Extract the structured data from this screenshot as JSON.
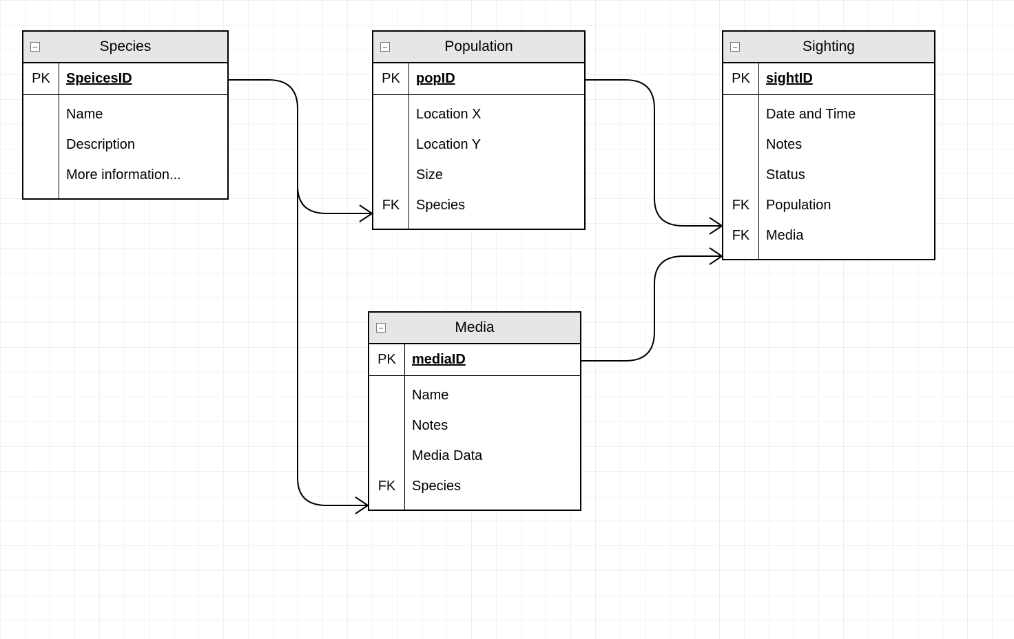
{
  "entities": {
    "species": {
      "title": "Species",
      "pk_label": "PK",
      "pk_attr": "SpeicesID",
      "rows": [
        {
          "key": "",
          "attr": "Name"
        },
        {
          "key": "",
          "attr": "Description"
        },
        {
          "key": "",
          "attr": "More information..."
        }
      ]
    },
    "population": {
      "title": "Population",
      "pk_label": "PK",
      "pk_attr": "popID",
      "rows": [
        {
          "key": "",
          "attr": "Location X"
        },
        {
          "key": "",
          "attr": "Location Y"
        },
        {
          "key": "",
          "attr": "Size"
        },
        {
          "key": "FK",
          "attr": "Species"
        }
      ]
    },
    "sighting": {
      "title": "Sighting",
      "pk_label": "PK",
      "pk_attr": "sightID",
      "rows": [
        {
          "key": "",
          "attr": "Date and Time"
        },
        {
          "key": "",
          "attr": "Notes"
        },
        {
          "key": "",
          "attr": "Status"
        },
        {
          "key": "FK",
          "attr": "Population"
        },
        {
          "key": "FK",
          "attr": "Media"
        }
      ]
    },
    "media": {
      "title": "Media",
      "pk_label": "PK",
      "pk_attr": "mediaID",
      "rows": [
        {
          "key": "",
          "attr": "Name"
        },
        {
          "key": "",
          "attr": "Notes"
        },
        {
          "key": "",
          "attr": "Media Data"
        },
        {
          "key": "FK",
          "attr": "Species"
        }
      ]
    }
  },
  "icons": {
    "collapse": "−"
  }
}
